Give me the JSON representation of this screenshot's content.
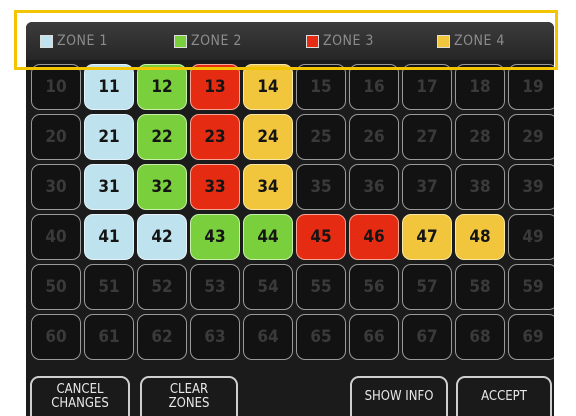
{
  "legend": [
    {
      "label": "ZONE 1",
      "color": "#bfe3ee"
    },
    {
      "label": "ZONE 2",
      "color": "#79cf3c"
    },
    {
      "label": "ZONE 3",
      "color": "#e52c12"
    },
    {
      "label": "ZONE 4",
      "color": "#f1c63d"
    }
  ],
  "grid": {
    "rows": [
      [
        {
          "n": "10",
          "z": 0
        },
        {
          "n": "11",
          "z": 1
        },
        {
          "n": "12",
          "z": 2
        },
        {
          "n": "13",
          "z": 3
        },
        {
          "n": "14",
          "z": 4
        },
        {
          "n": "15",
          "z": 0
        },
        {
          "n": "16",
          "z": 0
        },
        {
          "n": "17",
          "z": 0
        },
        {
          "n": "18",
          "z": 0
        },
        {
          "n": "19",
          "z": 0
        }
      ],
      [
        {
          "n": "20",
          "z": 0
        },
        {
          "n": "21",
          "z": 1
        },
        {
          "n": "22",
          "z": 2
        },
        {
          "n": "23",
          "z": 3
        },
        {
          "n": "24",
          "z": 4
        },
        {
          "n": "25",
          "z": 0
        },
        {
          "n": "26",
          "z": 0
        },
        {
          "n": "27",
          "z": 0
        },
        {
          "n": "28",
          "z": 0
        },
        {
          "n": "29",
          "z": 0
        }
      ],
      [
        {
          "n": "30",
          "z": 0
        },
        {
          "n": "31",
          "z": 1
        },
        {
          "n": "32",
          "z": 2
        },
        {
          "n": "33",
          "z": 3
        },
        {
          "n": "34",
          "z": 4
        },
        {
          "n": "35",
          "z": 0
        },
        {
          "n": "36",
          "z": 0
        },
        {
          "n": "37",
          "z": 0
        },
        {
          "n": "38",
          "z": 0
        },
        {
          "n": "39",
          "z": 0
        }
      ],
      [
        {
          "n": "40",
          "z": 0
        },
        {
          "n": "41",
          "z": 1
        },
        {
          "n": "42",
          "z": 1
        },
        {
          "n": "43",
          "z": 2
        },
        {
          "n": "44",
          "z": 2
        },
        {
          "n": "45",
          "z": 3
        },
        {
          "n": "46",
          "z": 3
        },
        {
          "n": "47",
          "z": 4
        },
        {
          "n": "48",
          "z": 4
        },
        {
          "n": "49",
          "z": 0
        }
      ],
      [
        {
          "n": "50",
          "z": 0
        },
        {
          "n": "51",
          "z": 0
        },
        {
          "n": "52",
          "z": 0
        },
        {
          "n": "53",
          "z": 0
        },
        {
          "n": "54",
          "z": 0
        },
        {
          "n": "55",
          "z": 0
        },
        {
          "n": "56",
          "z": 0
        },
        {
          "n": "57",
          "z": 0
        },
        {
          "n": "58",
          "z": 0
        },
        {
          "n": "59",
          "z": 0
        }
      ],
      [
        {
          "n": "60",
          "z": 0
        },
        {
          "n": "61",
          "z": 0
        },
        {
          "n": "62",
          "z": 0
        },
        {
          "n": "63",
          "z": 0
        },
        {
          "n": "64",
          "z": 0
        },
        {
          "n": "65",
          "z": 0
        },
        {
          "n": "66",
          "z": 0
        },
        {
          "n": "67",
          "z": 0
        },
        {
          "n": "68",
          "z": 0
        },
        {
          "n": "69",
          "z": 0
        }
      ]
    ]
  },
  "buttons": {
    "cancel": "CANCEL\nCHANGES",
    "clear": "CLEAR\nZONES",
    "show_info": "SHOW INFO",
    "accept": "ACCEPT"
  },
  "colors": {
    "highlight": "#f2c500",
    "background": "#1b1b1b"
  }
}
